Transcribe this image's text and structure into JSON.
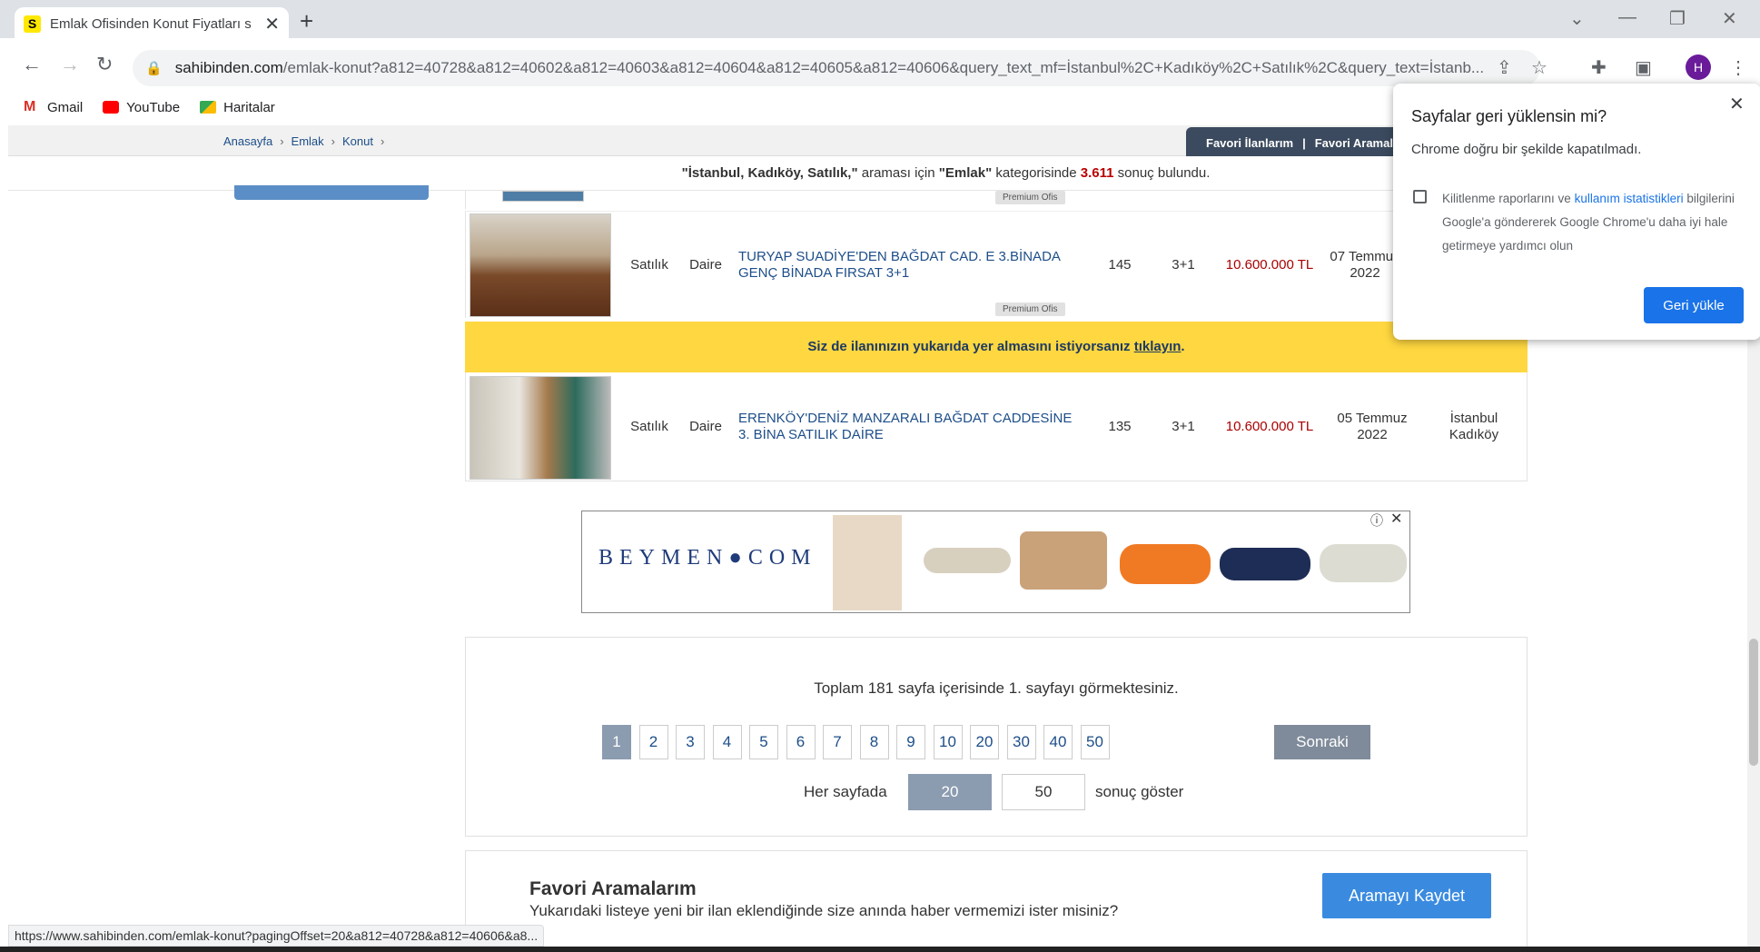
{
  "browser": {
    "tab_title": "Emlak Ofisinden Konut Fiyatları s",
    "favicon_letter": "S",
    "url_host": "sahibinden.com",
    "url_path": "/emlak-konut?a812=40728&a812=40602&a812=40603&a812=40604&a812=40605&a812=40606&query_text_mf=İstanbul%2C+Kadıköy%2C+Satılık%2C&query_text=İstanb...",
    "avatar_letter": "H",
    "bookmarks": [
      "Gmail",
      "YouTube",
      "Haritalar"
    ]
  },
  "breadcrumb": [
    "Anasayfa",
    "Emlak",
    "Konut"
  ],
  "favorites_bar": {
    "ilanlar": "Favori İlanlarım",
    "sep": "|",
    "aramalar": "Favori Aramalar"
  },
  "result": {
    "query": "\"İstanbul, Kadıköy, Satılık,\"",
    "middle": " araması için ",
    "category": "\"Emlak\"",
    "suffix": " kategorisinde ",
    "count": "3.611",
    "end": " sonuç bulundu."
  },
  "listings": [
    {
      "badge": "Premium Ofis"
    },
    {
      "status": "Satılık",
      "type": "Daire",
      "title": "TURYAP SUADİYE'DEN BAĞDAT CAD. E 3.BİNADA GENÇ BİNADA FIRSAT 3+1",
      "m2": "145",
      "rooms": "3+1",
      "price": "10.600.000 TL",
      "date": "07 Temmuz 2022",
      "badge": "Premium Ofis"
    },
    {
      "status": "Satılık",
      "type": "Daire",
      "title": "ERENKÖY'DENİZ MANZARALI BAĞDAT CADDESİNE 3. BİNA SATILIK DAİRE",
      "m2": "135",
      "rooms": "3+1",
      "price": "10.600.000 TL",
      "date": "05 Temmuz 2022",
      "location": "İstanbul Kadıköy"
    }
  ],
  "promo": {
    "text": "Siz de ilanınızın yukarıda yer almasını istiyorsanız ",
    "link": "tıklayın",
    "end": "."
  },
  "ad": {
    "brand": "BEYMEN●COM"
  },
  "pagination": {
    "info": "Toplam 181 sayfa içerisinde 1. sayfayı görmektesiniz.",
    "pages": [
      "1",
      "2",
      "3",
      "4",
      "5",
      "6",
      "7",
      "8",
      "9",
      "10",
      "20",
      "30",
      "40",
      "50"
    ],
    "current": "1",
    "next": "Sonraki",
    "per_page_label": "Her sayfada",
    "per_page_options": [
      "20",
      "50"
    ],
    "per_page_selected": "20",
    "per_page_suffix": "sonuç göster"
  },
  "favori": {
    "title": "Favori Aramalarım",
    "subtitle": "Yukarıdaki listeye yeni bir ilan eklendiğinde size anında haber vermemizi ister misiniz?",
    "button": "Aramayı Kaydet"
  },
  "status_url": "https://www.sahibinden.com/emlak-konut?pagingOffset=20&a812=40728&a812=40606&a8...",
  "restore_popup": {
    "title": "Sayfalar geri yüklensin mi?",
    "subtitle": "Chrome doğru bir şekilde kapatılmadı.",
    "check_text_1": "Kilitlenme raporlarını ve ",
    "check_link": "kullanım istatistikleri",
    "check_text_2": "bilgilerini Google'a göndererek Google Chrome'u daha iyi hale getirmeye yardımcı olun",
    "button": "Geri yükle"
  }
}
